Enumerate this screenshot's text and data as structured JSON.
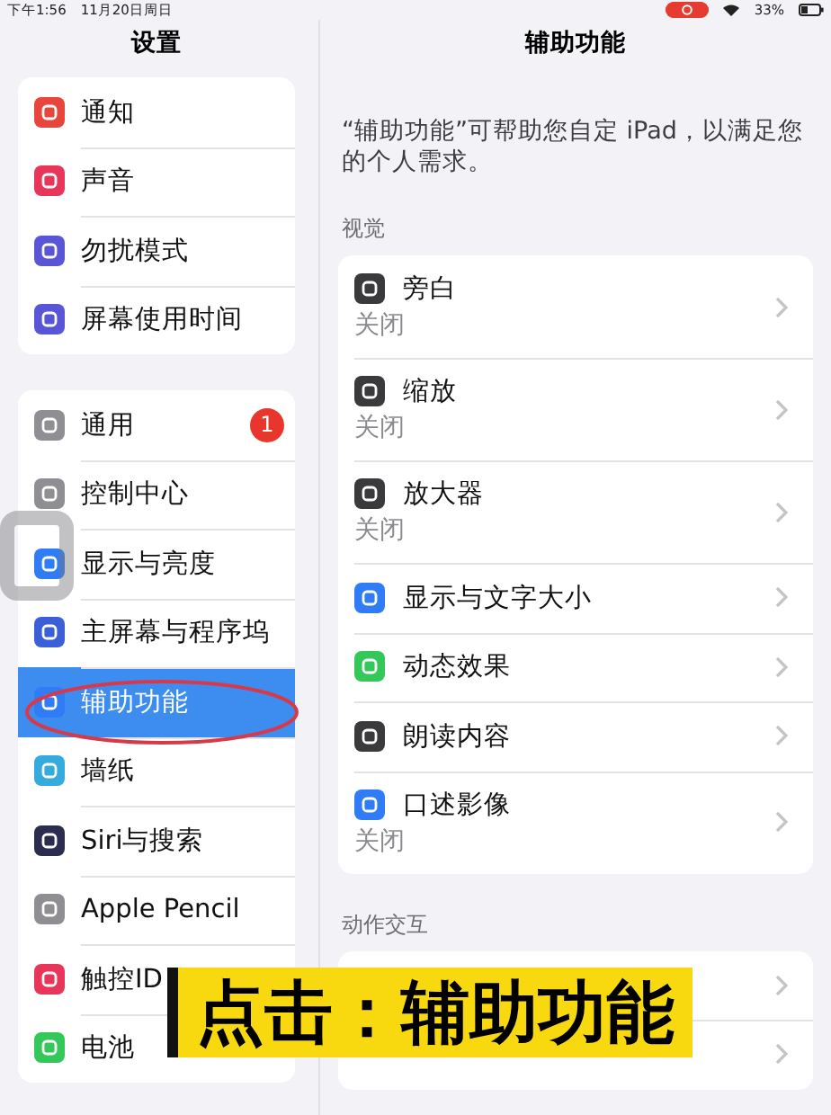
{
  "status_bar": {
    "time": "下午1:56",
    "date": "11月20日周日",
    "battery": "33%"
  },
  "sidebar": {
    "title": "设置",
    "groups": [
      [
        {
          "label": "通知",
          "color": "#e8453c",
          "selected": false
        },
        {
          "label": "声音",
          "color": "#e8365a",
          "selected": false
        },
        {
          "label": "勿扰模式",
          "color": "#5856d6",
          "selected": false
        },
        {
          "label": "屏幕使用时间",
          "color": "#5856d6",
          "selected": false
        }
      ],
      [
        {
          "label": "通用",
          "color": "#8e8e93",
          "selected": false,
          "badge": "1"
        },
        {
          "label": "控制中心",
          "color": "#8e8e93",
          "selected": false
        },
        {
          "label": "显示与亮度",
          "color": "#2f7cf6",
          "selected": false
        },
        {
          "label": "主屏幕与程序坞",
          "color": "#3a5fd8",
          "selected": false
        },
        {
          "label": "辅助功能",
          "color": "#2f7cf6",
          "selected": true
        },
        {
          "label": "墙纸",
          "color": "#35aadc",
          "selected": false
        },
        {
          "label": "Siri与搜索",
          "color": "#2c2c4e",
          "selected": false
        },
        {
          "label": "Apple Pencil",
          "color": "#8e8e93",
          "selected": false
        },
        {
          "label": "触控ID",
          "color": "#e8365a",
          "selected": false
        },
        {
          "label": "电池",
          "color": "#34c759",
          "selected": false
        }
      ]
    ]
  },
  "detail": {
    "title": "辅助功能",
    "description": "“辅助功能”可帮助您自定 iPad，以满足您的个人需求。",
    "sections": [
      {
        "header": "视觉",
        "rows": [
          {
            "title": "旁白",
            "value": "关闭",
            "color": "#3a3a3c"
          },
          {
            "title": "缩放",
            "value": "关闭",
            "color": "#3a3a3c"
          },
          {
            "title": "放大器",
            "value": "关闭",
            "color": "#3a3a3c"
          },
          {
            "title": "显示与文字大小",
            "color": "#2f7cf6"
          },
          {
            "title": "动态效果",
            "color": "#34c759"
          },
          {
            "title": "朗读内容",
            "color": "#3a3a3c"
          },
          {
            "title": "口述影像",
            "value": "关闭",
            "color": "#2f7cf6"
          }
        ]
      },
      {
        "header": "动作交互",
        "rows": [
          {},
          {}
        ]
      }
    ]
  },
  "caption": {
    "text": "点击：辅助功能"
  }
}
